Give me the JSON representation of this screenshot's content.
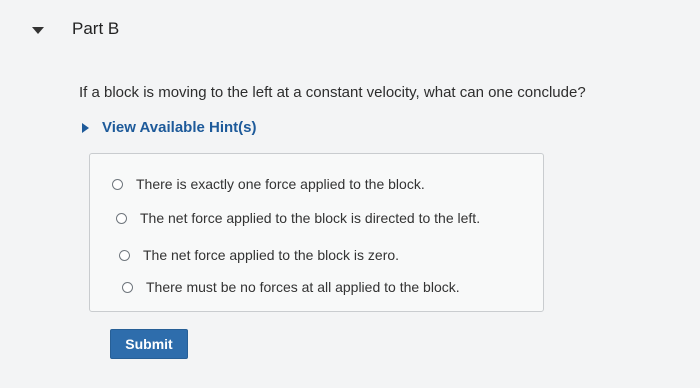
{
  "part": {
    "title": "Part B"
  },
  "question": {
    "text": "If a block is moving to the left at a constant velocity, what can one conclude?"
  },
  "hints": {
    "label": "View Available Hint(s)"
  },
  "options": [
    {
      "label": "There is exactly one force applied to the block."
    },
    {
      "label": "The net force applied to the block is directed to the left."
    },
    {
      "label": "The net force applied to the block is zero."
    },
    {
      "label": "There must be no forces at all applied to the block."
    }
  ],
  "submit": {
    "label": "Submit"
  },
  "colors": {
    "link": "#1d5a9a",
    "button": "#2e6dac",
    "background": "#f3f4f5"
  }
}
